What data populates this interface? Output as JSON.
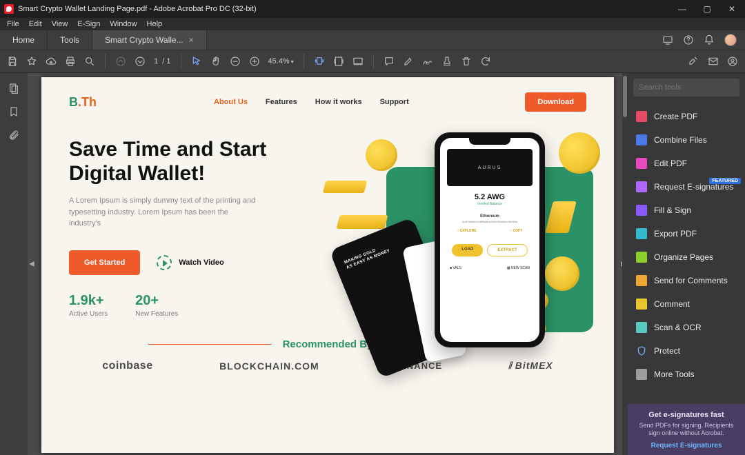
{
  "titlebar": {
    "title": "Smart Crypto Wallet Landing Page.pdf - Adobe Acrobat Pro DC (32-bit)"
  },
  "menubar": [
    "File",
    "Edit",
    "View",
    "E-Sign",
    "Window",
    "Help"
  ],
  "tabs": {
    "home": "Home",
    "tools": "Tools",
    "doc": "Smart Crypto Walle..."
  },
  "toolbar": {
    "page": {
      "current": "1",
      "sep": "/",
      "total": "1"
    },
    "zoom": "45.4%"
  },
  "rpanel": {
    "search_placeholder": "Search tools",
    "items": [
      {
        "label": "Create PDF",
        "ico": "red"
      },
      {
        "label": "Combine Files",
        "ico": "blue"
      },
      {
        "label": "Edit PDF",
        "ico": "pink"
      },
      {
        "label": "Request E-signatures",
        "ico": "purple",
        "badge": "FEATURED"
      },
      {
        "label": "Fill & Sign",
        "ico": "violet"
      },
      {
        "label": "Export PDF",
        "ico": "teal"
      },
      {
        "label": "Organize Pages",
        "ico": "lime"
      },
      {
        "label": "Send for Comments",
        "ico": "orange"
      },
      {
        "label": "Comment",
        "ico": "yellow"
      },
      {
        "label": "Scan & OCR",
        "ico": "cyan"
      },
      {
        "label": "Protect",
        "ico": "shield"
      },
      {
        "label": "More Tools",
        "ico": "grey"
      }
    ],
    "promo": {
      "h": "Get e-signatures fast",
      "d": "Send PDFs for signing. Recipients sign online without Acrobat.",
      "l": "Request E-signatures"
    }
  },
  "landing": {
    "logo": {
      "a": "B",
      "b": ".Th"
    },
    "nav": [
      "About Us",
      "Features",
      "How it works",
      "Support"
    ],
    "download": "Download",
    "headline_a": "Save Time and Start",
    "headline_b": "Digital Wallet!",
    "sub": "A Lorem Ipsum is simply dummy text of the printing and typesetting industry. Lorem Ipsum has been the industry's",
    "get_started": "Get Started",
    "watch": "Watch Video",
    "stat1_num": "1.9k+",
    "stat1_lab": "Active Users",
    "stat2_num": "20+",
    "stat2_lab": "New Features",
    "phone": {
      "brand": "AURUS",
      "amount": "5.2 AWG",
      "bal": "Verified Balance",
      "eth": "Ethereum",
      "hash": "0x4f7a3b9e2c1d8f6a5b4c3d2e1f0a9b8c7d6e5f4a",
      "explore": "EXPLORE",
      "copy": "COPY",
      "load": "LOAD",
      "extract": "EXTRACT",
      "vals": "VALS",
      "scan": "NEW SCAN"
    },
    "card_text": "MAKING GOLD\nAS EASY AS MONEY",
    "rec": "Recommended By",
    "logos": {
      "cb": "coinbase",
      "bc": "BLOCKCHAIN.COM",
      "bn": "BINANCE",
      "bm": "BitMEX"
    }
  }
}
